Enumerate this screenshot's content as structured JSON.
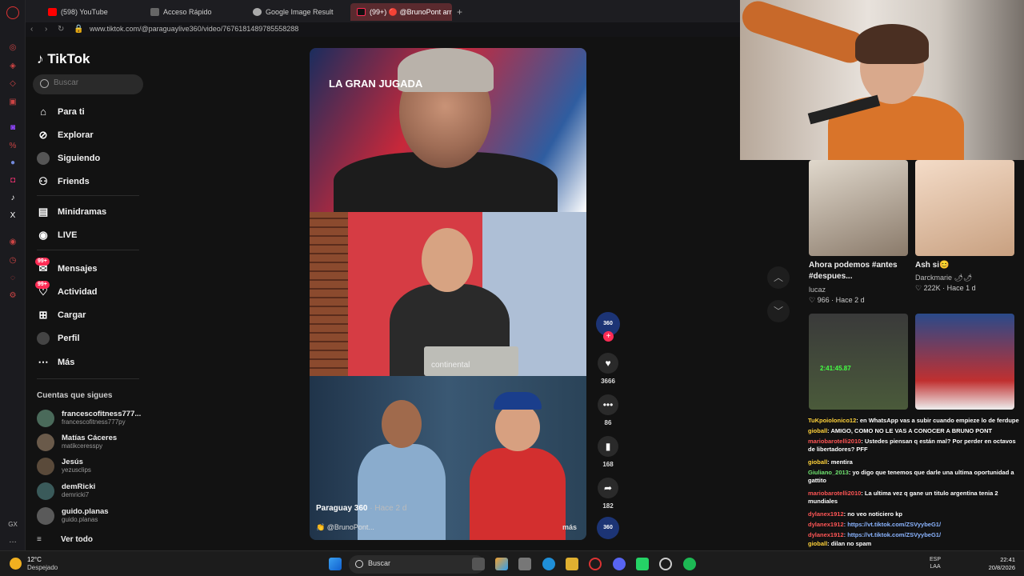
{
  "tabs": [
    {
      "label": "(598) YouTube",
      "color": "#ff0000"
    },
    {
      "label": "Acceso Rápido",
      "color": "#888888"
    },
    {
      "label": "Google Image Result",
      "color": "#aaaaaa"
    },
    {
      "label": "(99+) 🔴 @BrunoPont arre",
      "color": "#fe2c55",
      "active": true
    }
  ],
  "address": {
    "url": "www.tiktok.com/@paraguaylive360/video/7676181489785558288"
  },
  "sidebar": {
    "logo": "TikTok",
    "search_placeholder": "Buscar",
    "nav": [
      {
        "label": "Para ti",
        "icon": "home-icon"
      },
      {
        "label": "Explorar",
        "icon": "compass-icon"
      },
      {
        "label": "Siguiendo",
        "icon": "following-icon"
      },
      {
        "label": "Friends",
        "icon": "friends-icon"
      },
      {
        "label": "Minidramas",
        "icon": "film-icon"
      },
      {
        "label": "LIVE",
        "icon": "live-icon"
      },
      {
        "label": "Mensajes",
        "icon": "messages-icon",
        "badge": "99+"
      },
      {
        "label": "Actividad",
        "icon": "activity-icon",
        "badge": "99+"
      },
      {
        "label": "Cargar",
        "icon": "upload-icon"
      },
      {
        "label": "Perfil",
        "icon": "profile-icon"
      },
      {
        "label": "Más",
        "icon": "more-icon"
      }
    ],
    "following_title": "Cuentas que sigues",
    "following": [
      {
        "name": "francescofitness777...",
        "handle": "francescofitness777py"
      },
      {
        "name": "Matías Cáceres",
        "handle": "matikceresspy"
      },
      {
        "name": "Jesús",
        "handle": "yezusclips"
      },
      {
        "name": "demRicki",
        "handle": "demricki7"
      },
      {
        "name": "guido.planas",
        "handle": "guido.planas"
      }
    ],
    "see_all": "Ver todo"
  },
  "video": {
    "overlay_text": "LA GRAN JUGADA",
    "brand_text": "continental",
    "author": "Paraguay 360",
    "time": "· Hace 2 d",
    "user": "@BrunoPont...",
    "more": "más"
  },
  "actions": {
    "avatar_text": "360",
    "likes": "3666",
    "comments": "86",
    "saves": "168",
    "shares": "182"
  },
  "recommended": [
    {
      "title": "Ahora podemos #antes #despues...",
      "author": "lucaz",
      "stats": "♡ 966 · Hace 2 d"
    },
    {
      "title": "Ash si😊",
      "author": "Darckmarie 🌶🌶",
      "stats": "♡ 222K · Hace 1 d"
    }
  ],
  "stream_overlay": {
    "timer": "2:41:45.87"
  },
  "chat": [
    {
      "user": "TuKpoiolonico12",
      "msg": ": en WhatsApp vas a subir cuando empieze lo de ferdupe"
    },
    {
      "user": "gioball",
      "msg": ": AMIGO, COMO NO LE VAS A CONOCER A BRUNO PONT"
    },
    {
      "user": "mariobarotelli2010",
      "msg": ": Ustedes piensan q están mal? Por perder en octavos de libertadores? PFF"
    },
    {
      "user": "gioball",
      "msg": ": mentira"
    },
    {
      "user": "Giuliano_2013",
      "msg": ": yo digo que tenemos que darle una ultima oportunidad a gattito"
    },
    {
      "user": "mariobarotelli2010",
      "msg": ": La ultima vez q gane un titulo argentina tenia 2 mundiales"
    },
    {
      "user": "dylanex1912",
      "msg": ": no veo noticiero kp"
    },
    {
      "user": "dylanex1912",
      "msg": ": https://vt.tiktok.com/ZSVyybeG1/"
    },
    {
      "user": "dylanex1912",
      "msg": ": https://vt.tiktok.com/ZSVyybeG1/"
    },
    {
      "user": "dylanex1912",
      "msg": ": https://vt.tiktok.com/ZSVyybeG1/"
    },
    {
      "user": "gioball",
      "msg": ": dilan no spam"
    },
    {
      "user": "gioball",
      "msg": ": como alfaro"
    }
  ],
  "taskbar": {
    "temp": "12°C",
    "weather": "Despejado",
    "search": "Buscar",
    "lang": "ESP",
    "region": "LAA",
    "time": "22:41",
    "date": "20/8/2026"
  }
}
